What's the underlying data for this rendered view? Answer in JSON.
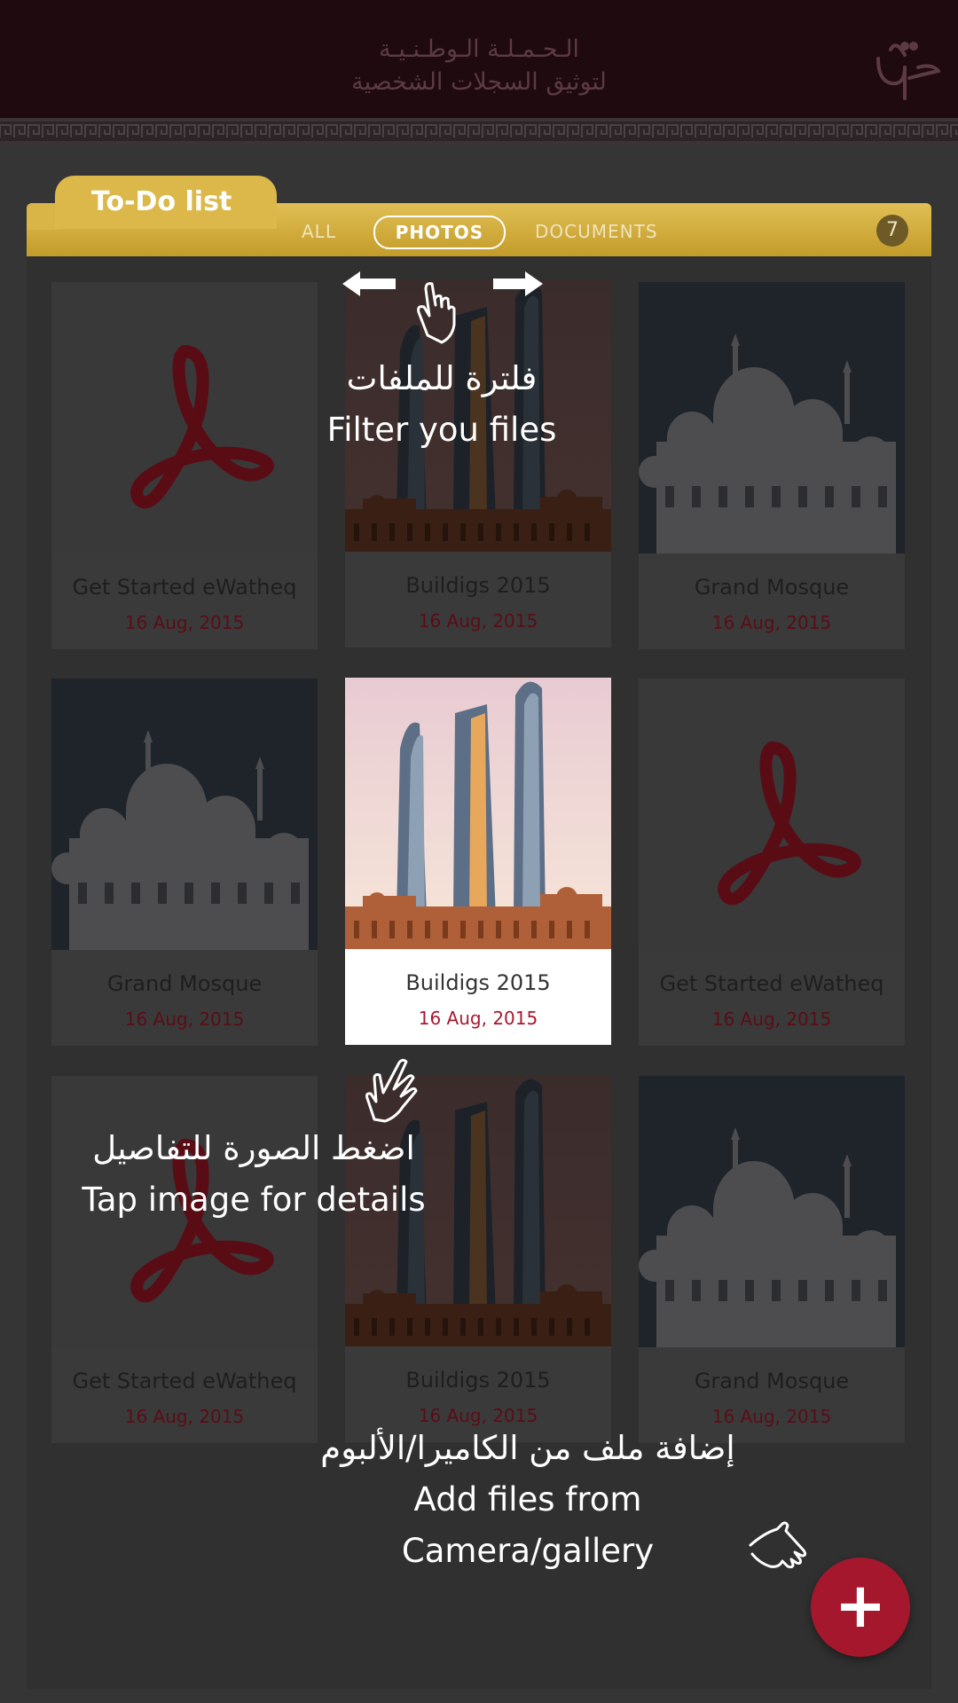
{
  "header": {
    "title_line1": "الـحـمـلـة الـوطـنـيـة",
    "title_line2": "لتوثيق السجلات الشخصية"
  },
  "tab": {
    "title": "To-Do list",
    "filters": [
      "ALL",
      "PHOTOS",
      "DOCUMENTS"
    ],
    "active_filter": "PHOTOS",
    "count": "7"
  },
  "cards": [
    {
      "title": "Get Started eWatheq",
      "date": "16 Aug, 2015",
      "kind": "pdf"
    },
    {
      "title": "Buildigs 2015",
      "date": "16 Aug, 2015",
      "kind": "towers"
    },
    {
      "title": "Grand Mosque",
      "date": "16 Aug, 2015",
      "kind": "mosque"
    },
    {
      "title": "Grand Mosque",
      "date": "16 Aug, 2015",
      "kind": "mosque"
    },
    {
      "title": "Buildigs 2015",
      "date": "16 Aug, 2015",
      "kind": "towers",
      "highlighted": true
    },
    {
      "title": "Get Started eWatheq",
      "date": "16 Aug, 2015",
      "kind": "pdf"
    },
    {
      "title": "Get Started eWatheq",
      "date": "16 Aug, 2015",
      "kind": "pdf"
    },
    {
      "title": "Buildigs 2015",
      "date": "16 Aug, 2015",
      "kind": "towers"
    },
    {
      "title": "Grand Mosque",
      "date": "16 Aug, 2015",
      "kind": "mosque"
    }
  ],
  "hints": {
    "filter_ar": "فلترة للملفات",
    "filter_en": "Filter you files",
    "tap_ar": "اضغط الصورة للتفاصيل",
    "tap_en": "Tap image for details",
    "add_ar": "إضافة ملف من الكاميرا/الألبوم",
    "add_en": "Add files from Camera/gallery"
  },
  "fab": {
    "label": "+"
  },
  "colors": {
    "accent": "#a5172c",
    "gold": "#d4ae3f",
    "header": "#1f0a10"
  }
}
